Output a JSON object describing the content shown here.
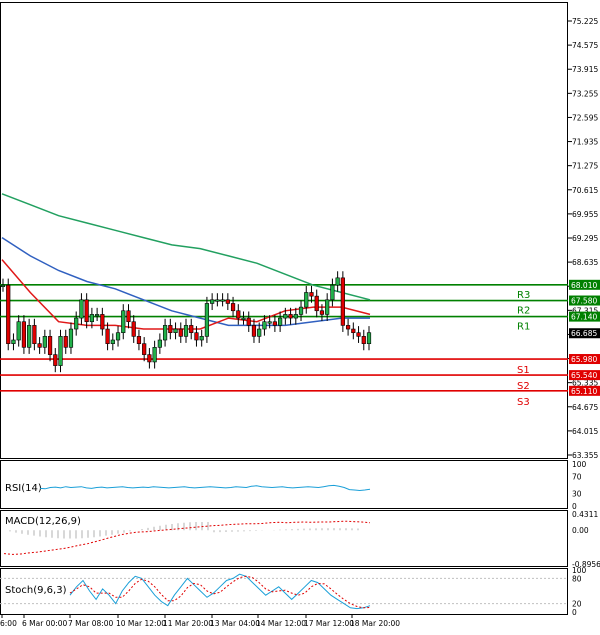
{
  "chart_data": {
    "type": "candlestick",
    "price_axis": {
      "ticks": [
        "75.225",
        "74.575",
        "73.915",
        "73.255",
        "72.595",
        "71.935",
        "71.275",
        "70.615",
        "69.955",
        "69.295",
        "68.635",
        "67.975",
        "67.315",
        "66.655",
        "65.995",
        "65.335",
        "64.675",
        "64.015",
        "63.355"
      ]
    },
    "time_axis": {
      "labels": [
        "6:00",
        "6 Mar 00:00",
        "7 Mar 08:00",
        "10 Mar 12:00",
        "11 Mar 20:00",
        "13 Mar 04:00",
        "14 Mar 12:00",
        "17 Mar 12:00",
        "18 Mar 20:00"
      ]
    },
    "current_price": "66.685",
    "levels": [
      {
        "name": "R3",
        "value": 68.01,
        "label": "68.010",
        "color": "#008000"
      },
      {
        "name": "R2",
        "value": 67.58,
        "label": "67.580",
        "color": "#008000"
      },
      {
        "name": "R1",
        "value": 67.14,
        "label": "67.140",
        "color": "#008000"
      },
      {
        "name": "S1",
        "value": 65.98,
        "label": "65.980",
        "color": "#e00000"
      },
      {
        "name": "S2",
        "value": 65.54,
        "label": "65.540",
        "color": "#e00000"
      },
      {
        "name": "S3",
        "value": 65.11,
        "label": "65.110",
        "color": "#e00000"
      }
    ],
    "candles_close": [
      68.0,
      66.4,
      66.5,
      67.0,
      66.3,
      66.9,
      66.4,
      66.3,
      66.6,
      66.1,
      65.8,
      66.6,
      66.3,
      66.8,
      67.1,
      67.6,
      67.0,
      67.2,
      67.2,
      66.8,
      66.4,
      66.5,
      66.7,
      67.3,
      67.0,
      66.6,
      66.4,
      66.1,
      65.9,
      66.3,
      66.5,
      66.9,
      66.7,
      66.8,
      66.6,
      66.9,
      66.7,
      66.5,
      66.6,
      67.5,
      67.6,
      67.6,
      67.6,
      67.5,
      67.3,
      67.1,
      67.1,
      66.9,
      66.6,
      66.8,
      67.0,
      67.0,
      66.9,
      67.1,
      67.2,
      67.1,
      67.2,
      67.4,
      67.8,
      67.7,
      67.3,
      67.2,
      67.6,
      68.0,
      68.2,
      66.9,
      66.8,
      66.7,
      66.6,
      66.4,
      66.7
    ],
    "moving_averages": [
      {
        "color": "#22a060",
        "values": [
          70.5,
          70.2,
          69.9,
          69.7,
          69.5,
          69.3,
          69.1,
          69.0,
          68.8,
          68.6,
          68.3,
          68.0,
          67.8,
          67.6
        ]
      },
      {
        "color": "#3060c0",
        "values": [
          69.3,
          68.8,
          68.4,
          68.1,
          67.9,
          67.6,
          67.3,
          67.1,
          66.9,
          66.9,
          66.9,
          67.0,
          67.1,
          67.1
        ]
      },
      {
        "color": "#e01818",
        "values": [
          68.7,
          67.8,
          67.0,
          66.9,
          66.9,
          66.8,
          66.8,
          66.8,
          67.1,
          67.0,
          67.3,
          67.4,
          67.4,
          67.2
        ]
      }
    ],
    "rsi": {
      "label": "RSI(14)",
      "ticks": [
        "100",
        "70",
        "30",
        "0"
      ],
      "values": [
        42,
        41,
        44,
        45,
        43,
        46,
        44,
        45,
        46,
        43,
        42,
        44,
        45,
        43,
        44,
        45,
        46,
        44,
        43,
        44,
        45,
        44,
        46,
        45,
        44,
        43,
        44,
        45,
        46,
        44,
        43,
        44,
        45,
        46,
        45,
        44,
        43,
        44,
        46,
        45,
        44,
        47,
        48,
        46,
        45,
        44,
        45,
        46,
        44,
        43,
        44,
        45,
        46,
        45,
        44,
        46,
        48,
        49,
        47,
        44,
        39,
        38,
        37,
        38,
        40
      ]
    },
    "macd": {
      "label": "MACD(12,26,9)",
      "ticks": [
        "0.4311",
        "0.00",
        "-0.8956"
      ],
      "values": [
        -0.62,
        -0.64,
        -0.63,
        -0.6,
        -0.58,
        -0.55,
        -0.52,
        -0.49,
        -0.45,
        -0.4,
        -0.36,
        -0.3,
        -0.24,
        -0.18,
        -0.12,
        -0.08,
        -0.05,
        -0.04,
        -0.02,
        0.0,
        0.02,
        0.04,
        0.06,
        0.08,
        0.1,
        0.12,
        0.13,
        0.15,
        0.16,
        0.17,
        0.17,
        0.18,
        0.2,
        0.21,
        0.2,
        0.21,
        0.22,
        0.21,
        0.22,
        0.22,
        0.23,
        0.24,
        0.23,
        0.22,
        0.2
      ]
    },
    "stoch": {
      "label": "Stoch(9,6,3)",
      "ticks": [
        "100",
        "80",
        "20",
        "0"
      ],
      "main": [
        40,
        60,
        75,
        50,
        30,
        55,
        40,
        20,
        50,
        70,
        85,
        80,
        60,
        40,
        25,
        15,
        40,
        60,
        80,
        65,
        50,
        35,
        45,
        60,
        75,
        80,
        90,
        85,
        70,
        55,
        40,
        50,
        60,
        45,
        30,
        45,
        60,
        75,
        70,
        55,
        40,
        30,
        20,
        10,
        8,
        10,
        15
      ],
      "signal": [
        45,
        55,
        65,
        60,
        45,
        45,
        45,
        35,
        35,
        50,
        68,
        78,
        73,
        60,
        42,
        27,
        27,
        38,
        58,
        68,
        65,
        50,
        43,
        47,
        60,
        72,
        82,
        85,
        82,
        70,
        55,
        48,
        50,
        52,
        45,
        40,
        45,
        60,
        68,
        67,
        55,
        42,
        30,
        20,
        13,
        10,
        11
      ]
    }
  }
}
